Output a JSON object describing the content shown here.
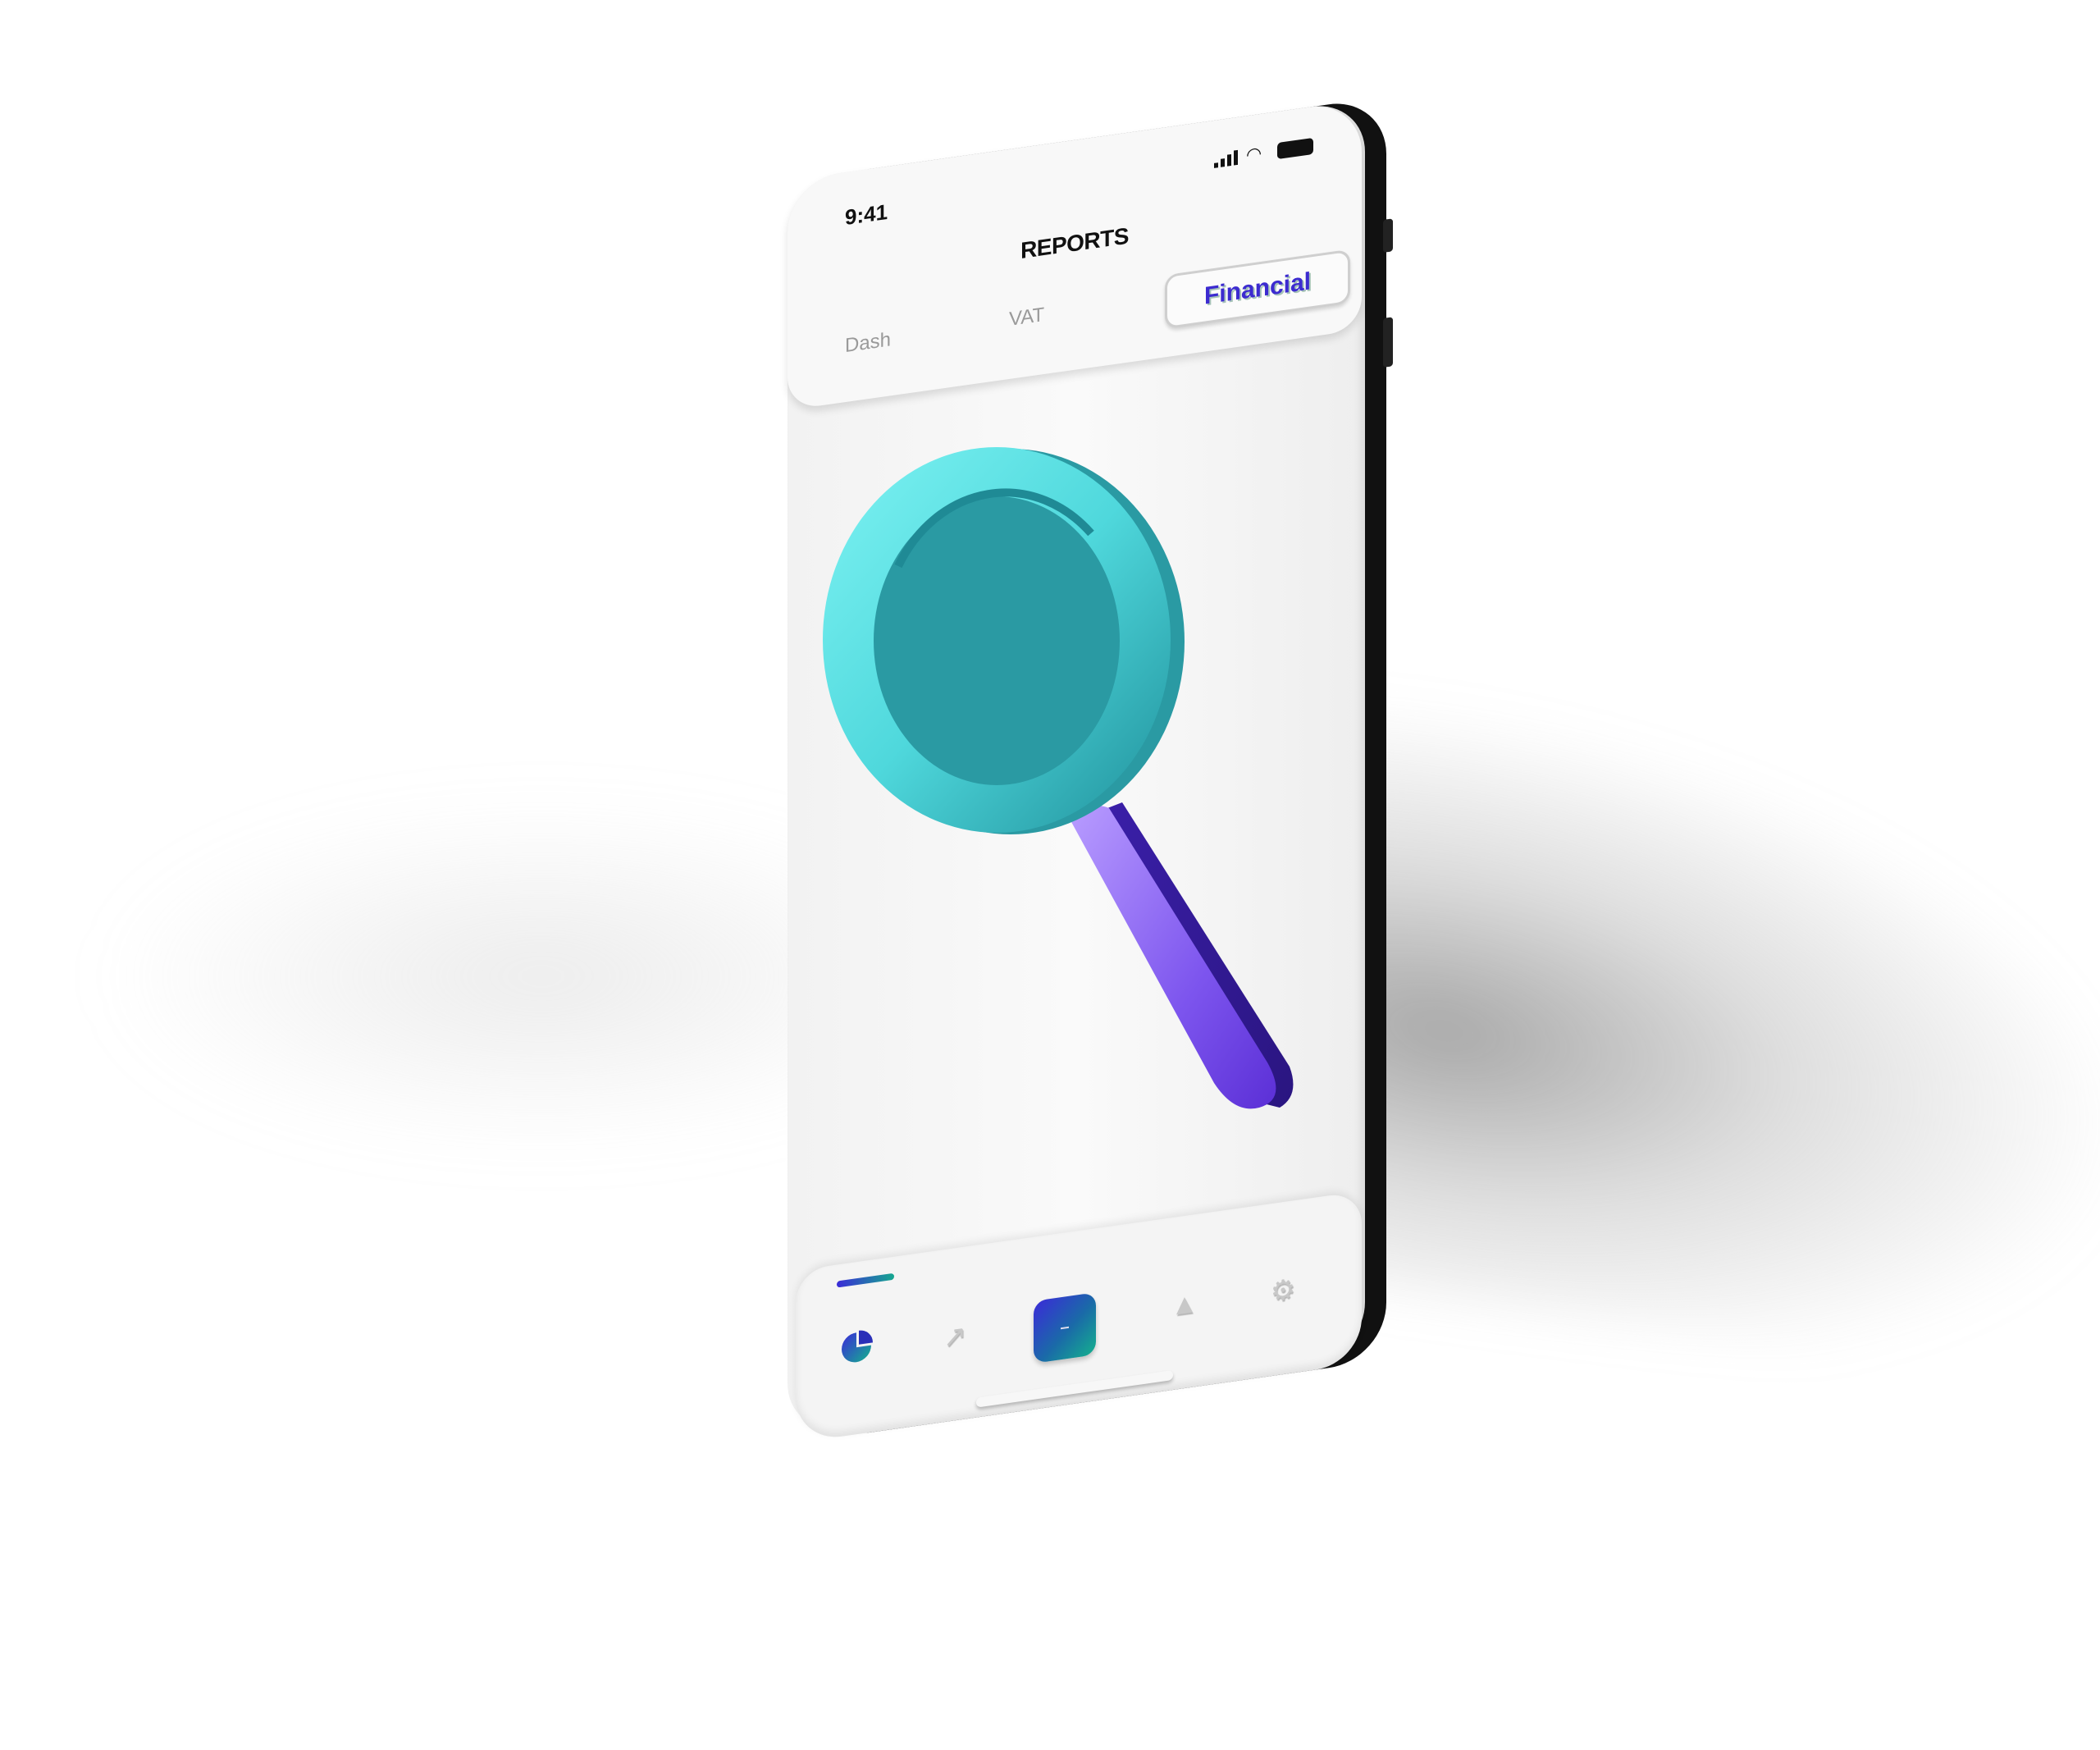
{
  "status_bar": {
    "time": "9:41"
  },
  "header": {
    "title": "REPORTS"
  },
  "tabs": [
    {
      "label": "Dash",
      "active": false
    },
    {
      "label": "VAT",
      "active": false
    },
    {
      "label": "Financial",
      "active": true
    }
  ],
  "illustration": {
    "icon": "magnifying-glass-icon",
    "ring_color": "#5fe0e0",
    "handle_color": "#8a5cf0"
  },
  "bottom_nav": {
    "items": [
      {
        "icon": "pie-chart-icon",
        "active": true
      },
      {
        "icon": "trend-chart-icon",
        "active": false
      },
      {
        "icon": "add-icon",
        "active": false,
        "primary": true
      },
      {
        "icon": "bell-icon",
        "active": false
      },
      {
        "icon": "gear-icon",
        "active": false
      }
    ]
  },
  "colors": {
    "accent_start": "#3a2bd8",
    "accent_end": "#14b08e",
    "active_tab_text": "#3c2bd0"
  }
}
